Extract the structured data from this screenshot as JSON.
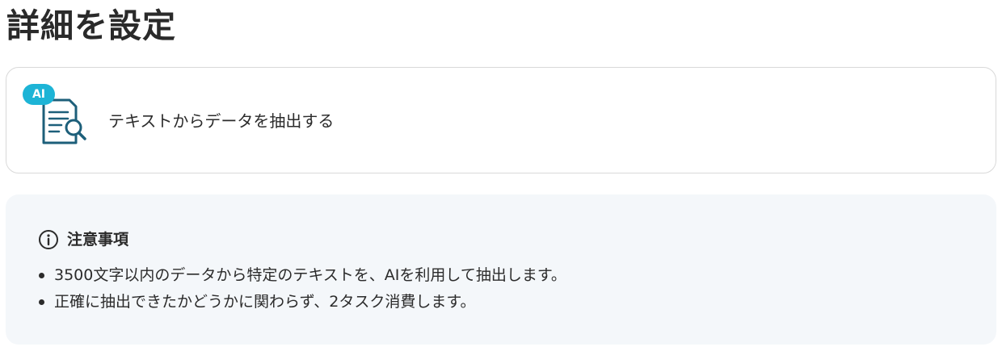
{
  "page": {
    "title": "詳細を設定"
  },
  "action_card": {
    "badge": "AI",
    "label": "テキストからデータを抽出する",
    "icon": "document-search-icon",
    "badge_color": "#1db4d6",
    "icon_color": "#1d5f7a"
  },
  "notice": {
    "icon": "info-icon",
    "title": "注意事項",
    "items": [
      "3500文字以内のデータから特定のテキストを、AIを利用して抽出します。",
      "正確に抽出できたかどうかに関わらず、2タスク消費します。"
    ],
    "background_color": "#f4f7fa"
  }
}
